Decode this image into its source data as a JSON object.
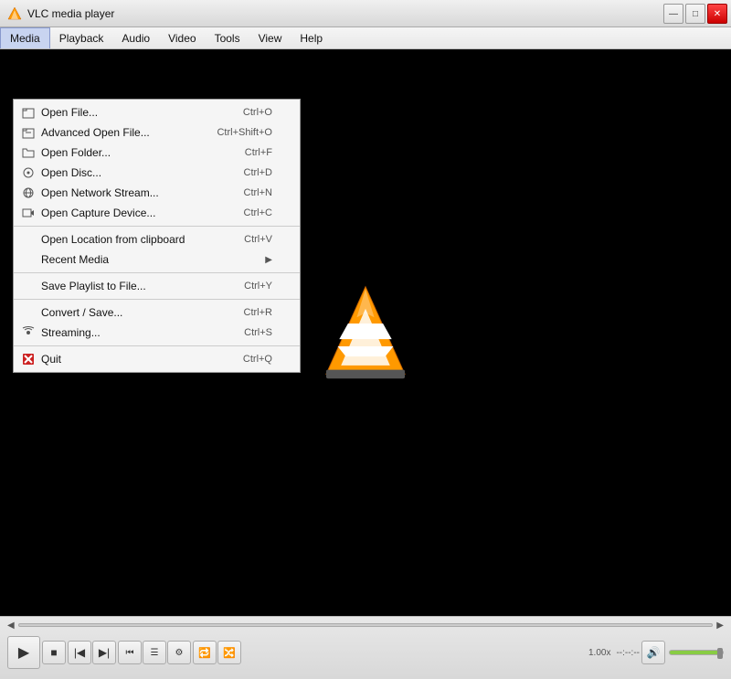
{
  "window": {
    "title": "VLC media player",
    "controls": {
      "minimize": "—",
      "maximize": "□",
      "close": "✕"
    }
  },
  "menubar": {
    "items": [
      {
        "id": "media",
        "label": "Media",
        "active": true
      },
      {
        "id": "playback",
        "label": "Playback"
      },
      {
        "id": "audio",
        "label": "Audio"
      },
      {
        "id": "video",
        "label": "Video"
      },
      {
        "id": "tools",
        "label": "Tools"
      },
      {
        "id": "view",
        "label": "View"
      },
      {
        "id": "help",
        "label": "Help"
      }
    ]
  },
  "media_menu": {
    "items": [
      {
        "id": "open-file",
        "label": "Open File...",
        "shortcut": "Ctrl+O",
        "icon": "file"
      },
      {
        "id": "advanced-open",
        "label": "Advanced Open File...",
        "shortcut": "Ctrl+Shift+O",
        "icon": "file-adv"
      },
      {
        "id": "open-folder",
        "label": "Open Folder...",
        "shortcut": "Ctrl+F",
        "icon": "folder"
      },
      {
        "id": "open-disc",
        "label": "Open Disc...",
        "shortcut": "Ctrl+D",
        "icon": "disc"
      },
      {
        "id": "open-network",
        "label": "Open Network Stream...",
        "shortcut": "Ctrl+N",
        "icon": "network"
      },
      {
        "id": "open-capture",
        "label": "Open Capture Device...",
        "shortcut": "Ctrl+C",
        "icon": "capture"
      },
      {
        "id": "sep1",
        "type": "separator"
      },
      {
        "id": "open-location",
        "label": "Open Location from clipboard",
        "shortcut": "Ctrl+V",
        "icon": ""
      },
      {
        "id": "recent-media",
        "label": "Recent Media",
        "shortcut": "",
        "icon": "",
        "arrow": true
      },
      {
        "id": "sep2",
        "type": "separator"
      },
      {
        "id": "save-playlist",
        "label": "Save Playlist to File...",
        "shortcut": "Ctrl+Y",
        "icon": ""
      },
      {
        "id": "sep3",
        "type": "separator"
      },
      {
        "id": "convert-save",
        "label": "Convert / Save...",
        "shortcut": "Ctrl+R",
        "icon": ""
      },
      {
        "id": "streaming",
        "label": "Streaming...",
        "shortcut": "Ctrl+S",
        "icon": "stream"
      },
      {
        "id": "sep4",
        "type": "separator"
      },
      {
        "id": "quit",
        "label": "Quit",
        "shortcut": "Ctrl+Q",
        "icon": "quit"
      }
    ]
  },
  "controls": {
    "seekbar_left": "",
    "seekbar_right": "",
    "speed": "1.00x",
    "time": "--:--:--",
    "volume_icon": "🔊",
    "volume_pct": "100%"
  }
}
